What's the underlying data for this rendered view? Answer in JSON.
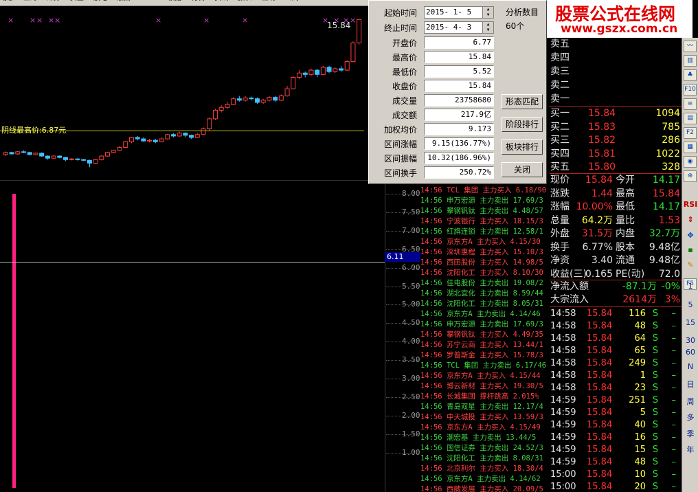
{
  "menu": [
    "动态",
    "上海",
    "深排",
    "资金",
    "股吧",
    "版面",
    "CALC",
    "板指",
    "行情",
    "资讯",
    "报表",
    "画线",
    "公式"
  ],
  "kline": {
    "high_label": "15.84",
    "hline_label": "阴线最高价:6.87元",
    "candles": [
      [
        6.4,
        6.55,
        6.3,
        6.62
      ],
      [
        6.55,
        6.45,
        6.4,
        6.6
      ],
      [
        6.45,
        6.6,
        6.38,
        6.65
      ],
      [
        6.6,
        6.55,
        6.5,
        6.7
      ],
      [
        6.55,
        6.4,
        6.35,
        6.6
      ],
      [
        6.4,
        6.5,
        6.35,
        6.55
      ],
      [
        6.5,
        6.3,
        6.25,
        6.55
      ],
      [
        6.3,
        6.15,
        6.05,
        6.35
      ],
      [
        6.15,
        6.3,
        6.1,
        6.35
      ],
      [
        6.3,
        6.2,
        6.15,
        6.35
      ],
      [
        6.2,
        6.05,
        5.95,
        6.25
      ],
      [
        6.05,
        6.1,
        6.0,
        6.15
      ],
      [
        6.1,
        6.05,
        5.98,
        6.15
      ],
      [
        6.05,
        6.0,
        5.95,
        6.1
      ],
      [
        6.0,
        5.8,
        5.52,
        6.05
      ],
      [
        5.8,
        6.05,
        5.75,
        6.1
      ],
      [
        6.05,
        6.3,
        6.0,
        6.35
      ],
      [
        6.3,
        6.55,
        6.25,
        6.6
      ],
      [
        6.55,
        6.7,
        6.5,
        6.75
      ],
      [
        6.7,
        6.9,
        6.65,
        7.0
      ],
      [
        6.9,
        7.3,
        6.85,
        7.35
      ],
      [
        7.3,
        7.6,
        7.2,
        7.65
      ],
      [
        7.6,
        7.5,
        7.4,
        7.7
      ],
      [
        7.5,
        7.35,
        7.3,
        7.6
      ],
      [
        7.35,
        7.4,
        7.25,
        7.5
      ],
      [
        7.4,
        7.3,
        7.2,
        7.5
      ],
      [
        7.3,
        7.5,
        7.25,
        7.6
      ],
      [
        7.5,
        7.8,
        7.45,
        7.85
      ],
      [
        7.8,
        7.7,
        7.6,
        7.9
      ],
      [
        7.7,
        7.9,
        7.65,
        8.0
      ],
      [
        7.9,
        7.75,
        7.6,
        7.95
      ],
      [
        7.75,
        7.6,
        7.5,
        7.8
      ],
      [
        7.6,
        7.8,
        7.55,
        7.9
      ],
      [
        7.8,
        8.2,
        7.75,
        8.3
      ],
      [
        8.2,
        8.9,
        8.1,
        9.0
      ],
      [
        8.9,
        9.5,
        8.8,
        9.6
      ],
      [
        9.5,
        9.7,
        9.35,
        9.85
      ],
      [
        9.7,
        9.9,
        9.6,
        10.1
      ],
      [
        9.9,
        10.3,
        9.85,
        10.4
      ],
      [
        10.3,
        10.2,
        10.1,
        10.5
      ],
      [
        10.2,
        10.35,
        10.1,
        10.5
      ],
      [
        10.35,
        10.3,
        10.2,
        10.45
      ],
      [
        10.3,
        10.05,
        9.95,
        10.4
      ],
      [
        10.05,
        10.2,
        9.95,
        10.3
      ],
      [
        10.2,
        10.4,
        10.1,
        10.5
      ],
      [
        10.4,
        10.2,
        10.1,
        10.5
      ],
      [
        10.2,
        10.5,
        10.15,
        10.6
      ],
      [
        10.5,
        11.0,
        10.45,
        11.2
      ],
      [
        11.0,
        11.8,
        10.95,
        11.9
      ],
      [
        11.8,
        12.1,
        11.7,
        12.3
      ],
      [
        12.1,
        12.0,
        11.8,
        12.2
      ],
      [
        12.0,
        12.3,
        11.9,
        12.4
      ],
      [
        12.3,
        12.0,
        11.8,
        12.4
      ],
      [
        12.0,
        12.5,
        11.95,
        12.6
      ],
      [
        12.5,
        12.2,
        12.1,
        12.6
      ],
      [
        12.2,
        12.4,
        12.1,
        12.5
      ],
      [
        12.4,
        12.3,
        12.2,
        12.6
      ],
      [
        12.3,
        12.9,
        12.25,
        13.0
      ],
      [
        12.9,
        14.2,
        12.85,
        14.3
      ],
      [
        14.2,
        15.84,
        14.1,
        15.84
      ]
    ]
  },
  "markers": [
    15,
    47,
    57,
    74,
    83,
    230,
    300,
    356,
    473,
    489,
    503,
    513
  ],
  "dialog": {
    "start_label": "起始时间",
    "start_value": "2015- 1- 5",
    "end_label": "终止时间",
    "end_value": "2015- 4- 3",
    "count_label": "分析数目",
    "count_value": "60个",
    "rows": [
      {
        "label": "开盘价",
        "value": "6.77"
      },
      {
        "label": "最高价",
        "value": "15.84"
      },
      {
        "label": "最低价",
        "value": "5.52"
      },
      {
        "label": "收盘价",
        "value": "15.84"
      },
      {
        "label": "成交量",
        "value": "23758680"
      },
      {
        "label": "成交额",
        "value": "217.9亿"
      },
      {
        "label": "加权均价",
        "value": "9.173"
      },
      {
        "label": "区间涨幅",
        "value": "9.15(136.77%)"
      },
      {
        "label": "区间振幅",
        "value": "10.32(186.96%)"
      },
      {
        "label": "区间换手",
        "value": "250.72%"
      }
    ],
    "btn_pattern": "形态匹配",
    "btn_rank": "阶段排行",
    "btn_sector": "板块排行",
    "btn_close": "关闭"
  },
  "banner": {
    "title": "股票公式在线网",
    "url": "www.gszx.com.cn"
  },
  "axis": {
    "labels": [
      "8.00",
      "7.50",
      "7.00",
      "6.50",
      "6.00",
      "5.50",
      "5.00",
      "4.50",
      "4.00",
      "3.50",
      "3.00",
      "2.50",
      "2.00",
      "1.50",
      "1.00"
    ],
    "cross_value": "6.11"
  },
  "ticker": [
    {
      "t": "14:56",
      "n": "TCL 集团",
      "a": "主力买入",
      "v": "6.18/90",
      "c": "#ff4040"
    },
    {
      "t": "14:56",
      "n": "申万宏源",
      "a": "主力卖出",
      "v": "17.69/3",
      "c": "#40d040"
    },
    {
      "t": "14:56",
      "n": "攀钢钒钛",
      "a": "主力卖出",
      "v": "4.48/57",
      "c": "#40d040"
    },
    {
      "t": "14:56",
      "n": "宁波银行",
      "a": "主力买入",
      "v": "18.15/3",
      "c": "#ff4040"
    },
    {
      "t": "14:56",
      "n": "红旗连锁",
      "a": "主力卖出",
      "v": "12.58/1",
      "c": "#40d040"
    },
    {
      "t": "14:56",
      "n": "京东方A",
      "a": "主力买入",
      "v": "4.15/30",
      "c": "#ff4040"
    },
    {
      "t": "14:56",
      "n": "深圳惠程",
      "a": "主力买入",
      "v": "15.10/3",
      "c": "#ff4040"
    },
    {
      "t": "14:56",
      "n": "西田股份",
      "a": "主力买入",
      "v": "14.98/5",
      "c": "#ff4040"
    },
    {
      "t": "14:56",
      "n": "沈阳化工",
      "a": "主力买入",
      "v": "8.10/30",
      "c": "#ff4040"
    },
    {
      "t": "14:56",
      "n": "佳电股份",
      "a": "主力卖出",
      "v": "19.08/2",
      "c": "#40d040"
    },
    {
      "t": "14:56",
      "n": "湖北宜化",
      "a": "主力卖出",
      "v": "8.59/44",
      "c": "#40d040"
    },
    {
      "t": "14:56",
      "n": "沈阳化工",
      "a": "主力卖出",
      "v": "8.05/31",
      "c": "#40d040"
    },
    {
      "t": "14:56",
      "n": "京东方A",
      "a": "主力卖出",
      "v": "4.14/46",
      "c": "#40d040"
    },
    {
      "t": "14:56",
      "n": "申万宏源",
      "a": "主力卖出",
      "v": "17.69/3",
      "c": "#40d040"
    },
    {
      "t": "14:56",
      "n": "攀钢钒钛",
      "a": "主力买入",
      "v": "4.49/35",
      "c": "#ff4040"
    },
    {
      "t": "14:56",
      "n": "苏宁云商",
      "a": "主力买入",
      "v": "13.44/1",
      "c": "#ff4040"
    },
    {
      "t": "14:56",
      "n": "罗普斯金",
      "a": "主力买入",
      "v": "15.78/3",
      "c": "#ff4040"
    },
    {
      "t": "14:56",
      "n": "TCL 集团",
      "a": "主力卖出",
      "v": "6.17/46",
      "c": "#40d040"
    },
    {
      "t": "14:56",
      "n": "京东方A",
      "a": "主力买入",
      "v": "4.15/44",
      "c": "#ff4040"
    },
    {
      "t": "14:56",
      "n": "博云新材",
      "a": "主力买入",
      "v": "19.30/5",
      "c": "#ff4040"
    },
    {
      "t": "14:56",
      "n": "长城集团",
      "a": "撑杆跳高",
      "v": "2.015%",
      "c": "#ff4040"
    },
    {
      "t": "14:56",
      "n": "青岛双星",
      "a": "主力卖出",
      "v": "12.17/4",
      "c": "#40d040"
    },
    {
      "t": "14:56",
      "n": "中天城投",
      "a": "主力买入",
      "v": "13.59/3",
      "c": "#ff4040"
    },
    {
      "t": "14:56",
      "n": "京东方A",
      "a": "主力买入",
      "v": "4.15/49",
      "c": "#ff4040"
    },
    {
      "t": "14:56",
      "n": "潮宏基",
      "a": "主力卖出",
      "v": "13.44/5",
      "c": "#40d040"
    },
    {
      "t": "14:56",
      "n": "国信证券",
      "a": "主力卖出",
      "v": "24.52/3",
      "c": "#40d040"
    },
    {
      "t": "14:56",
      "n": "沈阳化工",
      "a": "主力卖出",
      "v": "8.08/31",
      "c": "#40d040"
    },
    {
      "t": "14:56",
      "n": "北京利尔",
      "a": "主力买入",
      "v": "18.30/4",
      "c": "#ff4040"
    },
    {
      "t": "14:56",
      "n": "京东方A",
      "a": "主力卖出",
      "v": "4.14/62",
      "c": "#40d040"
    },
    {
      "t": "14:56",
      "n": "西藏发展",
      "a": "主力买入",
      "v": "20.09/5",
      "c": "#ff4040"
    }
  ],
  "orderbook": {
    "sells": [
      "卖五",
      "卖四",
      "卖三",
      "卖二",
      "卖一"
    ],
    "buys": [
      {
        "l": "买一",
        "p": "15.84",
        "v": "1094"
      },
      {
        "l": "买二",
        "p": "15.83",
        "v": "785"
      },
      {
        "l": "买三",
        "p": "15.82",
        "v": "286"
      },
      {
        "l": "买四",
        "p": "15.81",
        "v": "1022"
      },
      {
        "l": "买五",
        "p": "15.80",
        "v": "328"
      }
    ]
  },
  "stats": [
    {
      "l1": "现价",
      "v1": "15.84",
      "c1": "#ff3030",
      "l2": "今开",
      "v2": "14.17",
      "c2": "#30e030"
    },
    {
      "l1": "涨跌",
      "v1": "1.44",
      "c1": "#ff3030",
      "l2": "最高",
      "v2": "15.84",
      "c2": "#ff3030"
    },
    {
      "l1": "涨幅",
      "v1": "10.00%",
      "c1": "#ff3030",
      "l2": "最低",
      "v2": "14.17",
      "c2": "#30e030"
    },
    {
      "l1": "总量",
      "v1": "64.2万",
      "c1": "#ffff40",
      "l2": "量比",
      "v2": "1.53",
      "c2": "#ff3030"
    },
    {
      "l1": "外盘",
      "v1": "31.5万",
      "c1": "#ff3030",
      "l2": "内盘",
      "v2": "32.7万",
      "c2": "#30e030"
    },
    {
      "l1": "换手",
      "v1": "6.77%",
      "c1": "#e0e0e0",
      "l2": "股本",
      "v2": "9.48亿",
      "c2": "#e0e0e0"
    },
    {
      "l1": "净资",
      "v1": "3.40",
      "c1": "#e0e0e0",
      "l2": "流通",
      "v2": "9.48亿",
      "c2": "#e0e0e0"
    },
    {
      "l1": "收益(三)",
      "v1": "0.165",
      "c1": "#e0e0e0",
      "l2": "PE(动)",
      "v2": "72.0",
      "c2": "#e0e0e0"
    }
  ],
  "flow": [
    {
      "l": "净流入额",
      "v": "-87.1万",
      "c": "#30e030",
      "p": "-0%",
      "pc": "#30e030"
    },
    {
      "l": "大宗流入",
      "v": "2614万",
      "c": "#ff3030",
      "p": "3%",
      "pc": "#ff3030"
    }
  ],
  "ticks": [
    {
      "t": "14:58",
      "p": "15.84",
      "v": "116",
      "s": "S"
    },
    {
      "t": "14:58",
      "p": "15.84",
      "v": "48",
      "s": "S"
    },
    {
      "t": "14:58",
      "p": "15.84",
      "v": "64",
      "s": "S"
    },
    {
      "t": "14:58",
      "p": "15.84",
      "v": "65",
      "s": "S"
    },
    {
      "t": "14:58",
      "p": "15.84",
      "v": "249",
      "s": "S"
    },
    {
      "t": "14:58",
      "p": "15.84",
      "v": "1",
      "s": "S"
    },
    {
      "t": "14:58",
      "p": "15.84",
      "v": "23",
      "s": "S"
    },
    {
      "t": "14:59",
      "p": "15.84",
      "v": "251",
      "s": "S"
    },
    {
      "t": "14:59",
      "p": "15.84",
      "v": "5",
      "s": "S"
    },
    {
      "t": "14:59",
      "p": "15.84",
      "v": "40",
      "s": "S"
    },
    {
      "t": "14:59",
      "p": "15.84",
      "v": "16",
      "s": "S"
    },
    {
      "t": "14:59",
      "p": "15.84",
      "v": "15",
      "s": "S"
    },
    {
      "t": "14:59",
      "p": "15.84",
      "v": "48",
      "s": "S"
    },
    {
      "t": "15:00",
      "p": "15.84",
      "v": "10",
      "s": "S"
    },
    {
      "t": "15:00",
      "p": "15.84",
      "v": "20",
      "s": "S"
    }
  ],
  "toolbar": {
    "icons": [
      "chart-line-icon",
      "candle-icon",
      "tree-icon",
      "f10-icon",
      "list-icon",
      "book-icon",
      "f2-icon",
      "grid-icon",
      "camera-icon",
      "magnify-icon",
      "rsi-icon",
      "updown-icon",
      "move-icon",
      "dot-icon",
      "pen-icon",
      "f5-icon"
    ],
    "labels": [
      "RSI",
      "F5",
      "1",
      "5",
      "15",
      "30",
      "60",
      "N",
      "日",
      "周",
      "多",
      "季",
      "年"
    ]
  }
}
